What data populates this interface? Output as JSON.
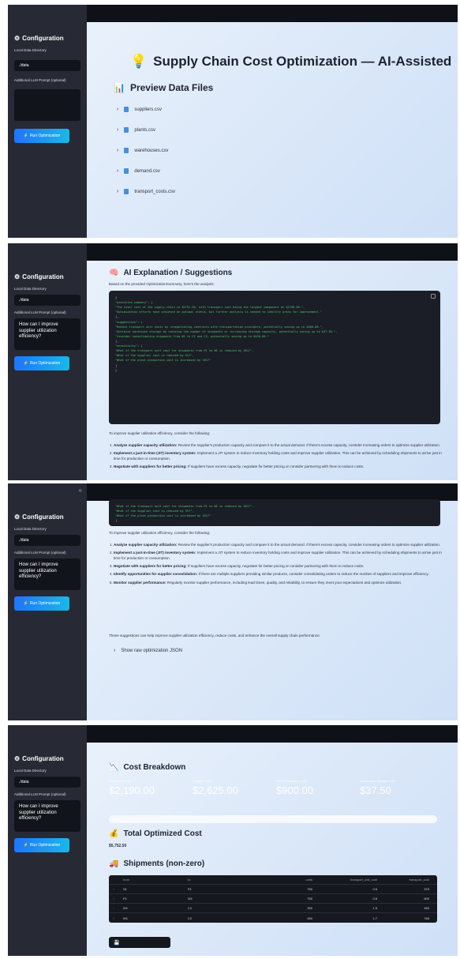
{
  "sidebar": {
    "collapse_glyph": "«",
    "title": "Configuration",
    "data_dir_label": "Local Data Directory",
    "data_dir_value": "./data",
    "prompt_label": "Additional LLM Prompt (optional)",
    "prompt_value": "How can I improve supplier utilization efficiency?",
    "run_label": "Run Optimization"
  },
  "main": {
    "title": "Supply Chain Cost Optimization — AI-Assisted",
    "preview_title": "Preview Data Files",
    "files": [
      "suppliers.csv",
      "plants.csv",
      "warehouses.csv",
      "demand.csv",
      "transport_costs.csv"
    ],
    "ai_title": "AI Explanation / Suggestions",
    "ai_intro": "Based on the provided OptimizationSummary, here's the analysis:",
    "code_lines": [
      "{",
      "  \"executive_summary\": [",
      "    \"The total cost of the supply chain is $5752.50, with transport cost being the largest component at $2190.00.\",",
      "    \"Optimization efforts have achieved an optimal status, but further analysis is needed to identify areas for improvement.\"",
      "  ],",
      "  \"suggestions\": [",
      "    \"Reduce transport unit costs by renegotiating contracts with transportation providers, potentially saving up to $500.00.\",",
      "    \"Optimize warehouse storage by reducing the number of shipments or increasing storage capacity, potentially saving up to $37.50.\",",
      "    \"Consider consolidating shipments from W1 to C1 and C2, potentially saving up to $450.00.\"",
      "  ],",
      "  \"sensitivity\": [",
      "    \"What if the transport unit cost for shipments from P1 to W1 is reduced by 10%?\",",
      "    \"What if the supplier cost is reduced by 5%?\",",
      "    \"What if the plant production cost is increased by 10%?\"",
      "  ]",
      "}"
    ],
    "code_tail": [
      "    \"What if the transport unit cost for shipments from P1 to W1 is reduced by 10%?\",",
      "    \"What if the supplier cost is reduced by 5%?\",",
      "    \"What if the plant production cost is increased by 10%?\"",
      "  ]",
      "}"
    ],
    "improve_intro": "To improve supplier utilization efficiency, consider the following:",
    "suggestions": [
      {
        "bold": "Analyze supplier capacity utilization:",
        "text": " Review the supplier's production capacity and compare it to the actual demand. If there's excess capacity, consider increasing orders to optimize supplier utilization."
      },
      {
        "bold": "Implement a just-in-time (JIT) inventory system:",
        "text": " Implement a JIT system to reduce inventory holding costs and improve supplier utilization. This can be achieved by scheduling shipments to arrive just in time for production or consumption."
      },
      {
        "bold": "Negotiate with suppliers for better pricing:",
        "text": " If suppliers have excess capacity, negotiate for better pricing or consider partnering with them to reduce costs."
      },
      {
        "bold": "Identify opportunities for supplier consolidation:",
        "text": " If there are multiple suppliers providing similar products, consider consolidating orders to reduce the number of suppliers and improve efficiency."
      },
      {
        "bold": "Monitor supplier performance:",
        "text": " Regularly monitor supplier performance, including lead times, quality, and reliability, to ensure they meet your expectations and optimize utilization."
      }
    ],
    "closing": "These suggestions can help improve supplier utilization efficiency, reduce costs, and enhance the overall supply chain performance.",
    "raw_json_label": "Show raw optimization JSON",
    "cost_title": "Cost Breakdown",
    "metrics": [
      {
        "label": "Transport Cost",
        "value": "$2,190.00"
      },
      {
        "label": "Supplier Cost",
        "value": "$2,625.00"
      },
      {
        "label": "Plant Production Cost",
        "value": "$900.00"
      },
      {
        "label": "Warehouse Storage Cost",
        "value": "$37.50"
      }
    ],
    "total_title": "Total Optimized Cost",
    "total_value": "$5,752.50",
    "shipments_title": "Shipments (non-zero)",
    "table": {
      "headers": [
        "from",
        "to",
        "units",
        "transport_unit_cost",
        "transport_cost"
      ],
      "rows": [
        [
          "S1",
          "P1",
          "750",
          "0.5",
          "375"
        ],
        [
          "P1",
          "W1",
          "750",
          "0.8",
          "600"
        ],
        [
          "W1",
          "C1",
          "300",
          "1.5",
          "450"
        ],
        [
          "W1",
          "C2",
          "450",
          "1.7",
          "765"
        ]
      ]
    }
  }
}
